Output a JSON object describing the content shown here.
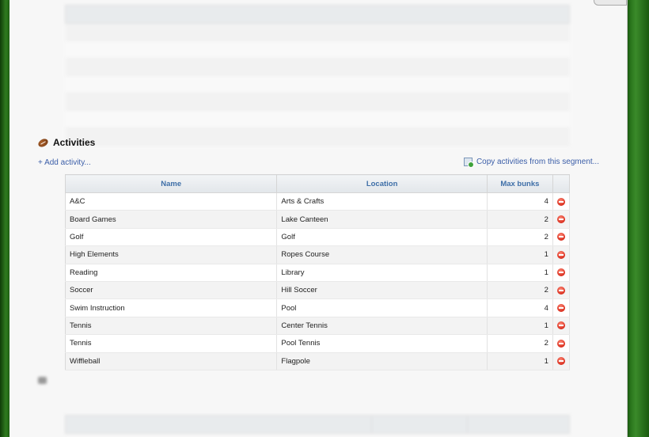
{
  "activities": {
    "title": "Activities",
    "add_label": "+ Add activity...",
    "copy_label": "Copy activities from this segment...",
    "columns": [
      "Name",
      "Location",
      "Max bunks"
    ],
    "rows": [
      {
        "name": "A&C",
        "location": "Arts & Crafts",
        "max_bunks": "4"
      },
      {
        "name": "Board Games",
        "location": "Lake Canteen",
        "max_bunks": "2"
      },
      {
        "name": "Golf",
        "location": "Golf",
        "max_bunks": "2"
      },
      {
        "name": "High Elements",
        "location": "Ropes Course",
        "max_bunks": "1"
      },
      {
        "name": "Reading",
        "location": "Library",
        "max_bunks": "1"
      },
      {
        "name": "Soccer",
        "location": "Hill Soccer",
        "max_bunks": "2"
      },
      {
        "name": "Swim Instruction",
        "location": "Pool",
        "max_bunks": "4"
      },
      {
        "name": "Tennis",
        "location": "Center Tennis",
        "max_bunks": "1"
      },
      {
        "name": "Tennis",
        "location": "Pool Tennis",
        "max_bunks": "2"
      },
      {
        "name": "Wiffleball",
        "location": "Flagpole",
        "max_bunks": "1"
      }
    ]
  },
  "icons": {
    "section": "football-icon",
    "copy": "copy-segment-icon",
    "remove": "remove-icon"
  },
  "colors": {
    "link": "#3b5ea8",
    "header_text": "#3f6fa8",
    "remove": "#d92c1c",
    "background_green": "#1f5e12"
  }
}
